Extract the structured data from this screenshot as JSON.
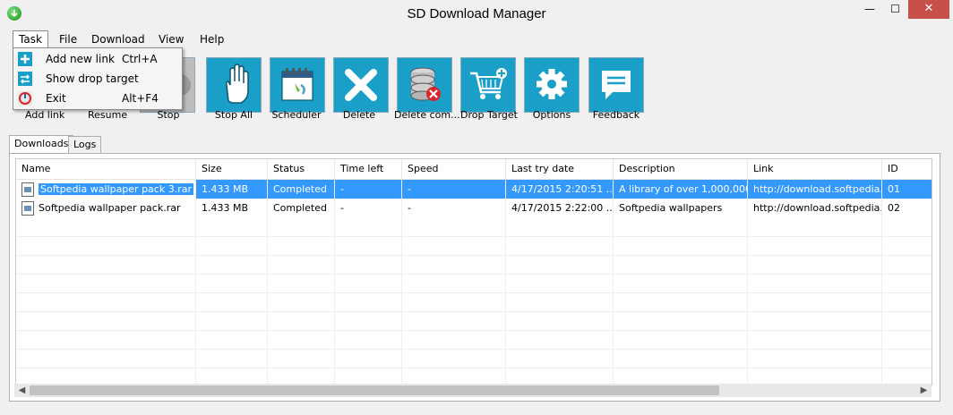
{
  "window": {
    "title": "SD Download Manager",
    "minimize": "—",
    "maximize": "☐",
    "close": "✕"
  },
  "menu": [
    {
      "label": "Task"
    },
    {
      "label": "File"
    },
    {
      "label": "Download"
    },
    {
      "label": "View"
    },
    {
      "label": "Help"
    }
  ],
  "task_menu": [
    {
      "label": "Add new link",
      "shortcut": "Ctrl+A",
      "icon": "plus-icon"
    },
    {
      "label": "Show drop target",
      "shortcut": "",
      "icon": "drop-target-icon"
    },
    {
      "label": "Exit",
      "shortcut": "Alt+F4",
      "icon": "exit-icon"
    }
  ],
  "toolbar": [
    {
      "label": "Add link",
      "icon": "add-link-icon"
    },
    {
      "label": "Resume",
      "icon": "resume-icon"
    },
    {
      "label": "Stop",
      "icon": "stop-icon"
    },
    {
      "label": "Stop All",
      "icon": "hand-icon"
    },
    {
      "label": "Scheduler",
      "icon": "calendar-icon"
    },
    {
      "label": "Delete",
      "icon": "x-icon"
    },
    {
      "label": "Delete com...",
      "icon": "database-delete-icon"
    },
    {
      "label": "Drop Target",
      "icon": "cart-icon"
    },
    {
      "label": "Options",
      "icon": "gear-icon"
    },
    {
      "label": "Feedback",
      "icon": "speech-bubble-icon"
    }
  ],
  "tabs": [
    {
      "label": "Downloads"
    },
    {
      "label": "Logs"
    }
  ],
  "table": {
    "columns": [
      "Name",
      "Size",
      "Status",
      "Time left",
      "Speed",
      "Last try date",
      "Description",
      "Link",
      "ID"
    ],
    "rows": [
      {
        "name": "Softpedia wallpaper pack 3.rar",
        "size": "1.433 MB",
        "status": "Completed",
        "time_left": "-",
        "speed": "-",
        "last_try": "4/17/2015 2:20:51 ...",
        "description": "A library of over 1,000,000 ...",
        "link": "http://download.softpedia....",
        "id": "01",
        "selected": true
      },
      {
        "name": "Softpedia wallpaper pack.rar",
        "size": "1.433 MB",
        "status": "Completed",
        "time_left": "-",
        "speed": "-",
        "last_try": "4/17/2015 2:22:00 ...",
        "description": "Softpedia wallpapers",
        "link": "http://download.softpedia....",
        "id": "02",
        "selected": false
      }
    ]
  },
  "scrollbar": {
    "left": "◀",
    "right": "▶"
  },
  "colors": {
    "accent": "#1aa0c8",
    "selection": "#3399ff",
    "close": "#c7504a"
  }
}
